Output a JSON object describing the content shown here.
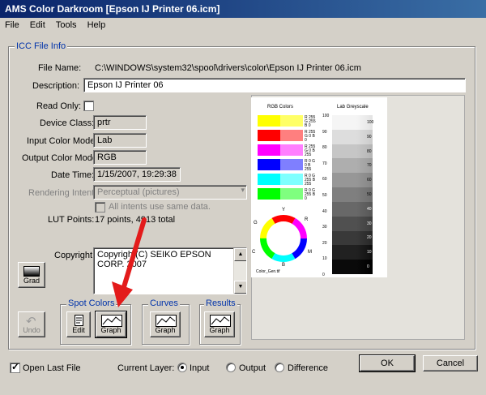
{
  "window": {
    "title": "AMS Color Darkroom [Epson IJ Printer 06.icm]"
  },
  "menu": [
    "File",
    "Edit",
    "Tools",
    "Help"
  ],
  "icc_group": {
    "legend": "ICC File Info"
  },
  "fields": {
    "file_name_label": "File Name:",
    "file_name_value": "C:\\WINDOWS\\system32\\spool\\drivers\\color\\Epson IJ Printer 06.icm",
    "description_label": "Description:",
    "description_value": "Epson IJ Printer 06",
    "read_only_label": "Read Only:",
    "device_class_label": "Device Class:",
    "device_class_value": "prtr",
    "input_mode_label": "Input Color Mode:",
    "input_mode_value": "Lab",
    "output_mode_label": "Output Color Mode:",
    "output_mode_value": "RGB",
    "date_time_label": "Date Time:",
    "date_time_value": "1/15/2007, 19:29:38",
    "rendering_label": "Rendering Intent:",
    "rendering_value": "Perceptual (pictures)",
    "all_intents_label": "All intents use same data.",
    "lut_label": "LUT Points:",
    "lut_value": "17 points, 4913 total",
    "copyright_label": "Copyright:",
    "copyright_value": "Copyright(C) SEIKO EPSON CORP. 2007"
  },
  "buttons": {
    "grad": "Grad",
    "undo": "Undo",
    "edit": "Edit",
    "graph": "Graph",
    "ok": "OK",
    "cancel": "Cancel"
  },
  "groups": {
    "spot_colors": "Spot Colors",
    "curves": "Curves",
    "results": "Results"
  },
  "bottom": {
    "open_last_file": "Open Last File",
    "current_layer_label": "Current Layer:",
    "radio_input": "Input",
    "radio_output": "Output",
    "radio_difference": "Difference"
  },
  "preview": {
    "rgb_title": "RGB Colors",
    "lab_title": "Lab Greyscale",
    "wheel_caption": "Color_Gen.tif",
    "wheel_letters": [
      "Y",
      "R",
      "G",
      "C",
      "M",
      "B"
    ],
    "swatch_rows": [
      {
        "left": "#ffff00",
        "right": "#ffff66",
        "text": "R 255 G 255 B 0"
      },
      {
        "left": "#ff0000",
        "right": "#ff7f7f",
        "text": "R 255 G 0 B 0"
      },
      {
        "left": "#ff00ff",
        "right": "#ff7fff",
        "text": "R 255 G 0 B 255"
      },
      {
        "left": "#0000ff",
        "right": "#7f7fff",
        "text": "R 0 G 0 B 255"
      },
      {
        "left": "#00ffff",
        "right": "#7fffff",
        "text": "R 0 G 255 B 255"
      },
      {
        "left": "#00ff00",
        "right": "#7fff7f",
        "text": "R 0 G 255 B 0"
      }
    ],
    "gray_ticks": [
      "100",
      "90",
      "80",
      "70",
      "60",
      "50",
      "40",
      "30",
      "20",
      "10",
      "0"
    ],
    "gray_values": [
      "100",
      "90",
      "80",
      "70",
      "60",
      "50",
      "40",
      "30",
      "20",
      "10",
      "0"
    ]
  },
  "colors": {
    "titlebar_start": "#0a246a",
    "titlebar_end": "#3a6ea5",
    "dialog": "#d4d0c8",
    "legend_text": "#0033aa",
    "arrow": "#e31b1b"
  },
  "state": {
    "read_only": false,
    "open_last_file": true,
    "current_layer": "input"
  }
}
